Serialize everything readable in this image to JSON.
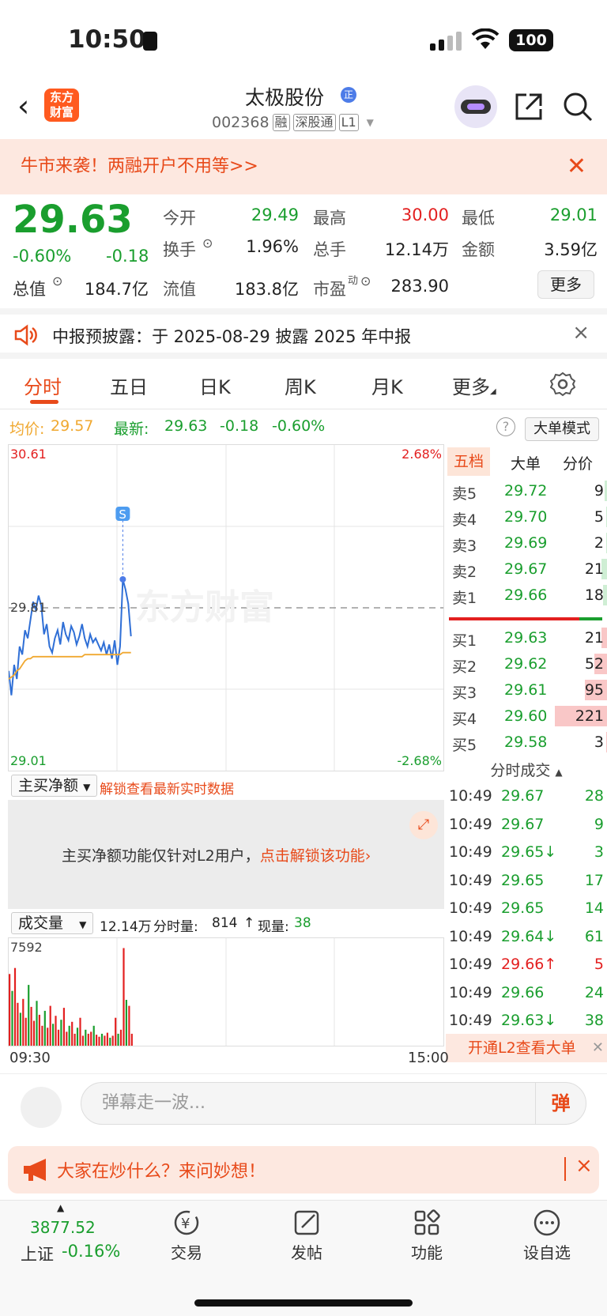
{
  "status": {
    "time": "10:50",
    "battery": "100"
  },
  "header": {
    "brand_top": "东方",
    "brand_bottom": "财富",
    "title": "太极股份",
    "badge": "正",
    "code": "002368",
    "tags": [
      "融",
      "深股通",
      "L1"
    ]
  },
  "promo": {
    "text": "牛市来袭！两融开户不用等>>"
  },
  "quote": {
    "price": "29.63",
    "pct": "-0.60%",
    "change": "-0.18",
    "grid": [
      {
        "label": "今开",
        "value": "29.49",
        "color": "green"
      },
      {
        "label": "最高",
        "value": "30.00",
        "color": "red"
      },
      {
        "label": "最低",
        "value": "29.01",
        "color": "green"
      },
      {
        "label": "换手",
        "value": "1.96%",
        "color": ""
      },
      {
        "label": "总手",
        "value": "12.14万",
        "color": ""
      },
      {
        "label": "金额",
        "value": "3.59亿",
        "color": ""
      },
      {
        "label": "总值",
        "value": "184.7亿",
        "color": ""
      },
      {
        "label": "流值",
        "value": "183.8亿",
        "color": ""
      },
      {
        "label": "市盈",
        "value": "283.90",
        "color": ""
      }
    ],
    "pe_sup": "动",
    "more": "更多"
  },
  "notice": {
    "text": "中报预披露：于 2025-08-29 披露 2025 年中报"
  },
  "tabs": [
    "分时",
    "五日",
    "日K",
    "周K",
    "月K",
    "更多"
  ],
  "avg": {
    "avg_label": "均价:",
    "avg_value": "29.57",
    "latest_label": "最新:",
    "latest_value": "29.63",
    "latest_chg": "-0.18",
    "latest_pct": "-0.60%",
    "big_mode": "大单模式",
    "help": "?"
  },
  "chart": {
    "y_top": "30.61",
    "y_mid": "29.81",
    "y_bot": "29.01",
    "pct_top": "2.68%",
    "pct_bot": "-2.68%",
    "watermark": "东方财富",
    "marker": "S"
  },
  "chart_data": {
    "type": "line",
    "title": "",
    "xlabel": "",
    "ylabel": "",
    "ylim": [
      29.01,
      30.61
    ],
    "x_range": [
      "09:30",
      "15:00"
    ],
    "series": [
      {
        "name": "",
        "color": "#2f6fd6",
        "values": [
          29.5,
          29.38,
          29.53,
          29.46,
          29.62,
          29.58,
          29.7,
          29.66,
          29.75,
          29.84,
          29.8,
          29.87,
          29.82,
          29.68,
          29.73,
          29.62,
          29.59,
          29.66,
          29.7,
          29.63,
          29.74,
          29.68,
          29.65,
          29.72,
          29.69,
          29.63,
          29.67,
          29.73,
          29.66,
          29.62,
          29.68,
          29.64,
          29.66,
          29.63,
          29.6,
          29.64,
          29.58,
          29.63,
          29.56,
          29.65,
          29.53,
          29.62,
          29.95,
          29.9,
          29.83,
          29.67
        ]
      },
      {
        "name": "",
        "color": "#f0a830",
        "values": [
          29.46,
          29.47,
          29.48,
          29.5,
          29.51,
          29.53,
          29.55,
          29.56,
          29.56,
          29.57,
          29.57,
          29.57,
          29.57,
          29.57,
          29.57,
          29.57,
          29.57,
          29.57,
          29.57,
          29.57,
          29.57,
          29.57,
          29.57,
          29.57,
          29.57,
          29.57,
          29.57,
          29.57,
          29.58,
          29.58,
          29.58,
          29.58,
          29.58,
          29.58,
          29.58,
          29.58,
          29.58,
          29.58,
          29.58,
          29.58,
          29.58,
          29.58,
          29.59,
          29.59,
          29.59,
          29.59
        ]
      }
    ]
  },
  "orderbook": {
    "tabs": [
      "五档",
      "大单",
      "分价"
    ],
    "asks": [
      {
        "name": "卖5",
        "price": "29.72",
        "vol": "9",
        "share": 0.04
      },
      {
        "name": "卖4",
        "price": "29.70",
        "vol": "5",
        "share": 0.02
      },
      {
        "name": "卖3",
        "price": "29.69",
        "vol": "2",
        "share": 0.01
      },
      {
        "name": "卖2",
        "price": "29.67",
        "vol": "21",
        "share": 0.1
      },
      {
        "name": "卖1",
        "price": "29.66",
        "vol": "18",
        "share": 0.08
      }
    ],
    "bids": [
      {
        "name": "买1",
        "price": "29.63",
        "vol": "21",
        "share": 0.1
      },
      {
        "name": "买2",
        "price": "29.62",
        "vol": "52",
        "share": 0.24
      },
      {
        "name": "买3",
        "price": "29.61",
        "vol": "95",
        "share": 0.43
      },
      {
        "name": "买4",
        "price": "29.60",
        "vol": "221",
        "share": 1.0
      },
      {
        "name": "买5",
        "price": "29.58",
        "vol": "3",
        "share": 0.01
      }
    ]
  },
  "trades": {
    "title": "分时成交",
    "rows": [
      {
        "t": "10:49",
        "p": "29.67",
        "v": "28",
        "vc": "green"
      },
      {
        "t": "10:49",
        "p": "29.67",
        "v": "9",
        "vc": "green"
      },
      {
        "t": "10:49",
        "p": "29.65↓",
        "v": "3",
        "vc": "green"
      },
      {
        "t": "10:49",
        "p": "29.65",
        "v": "17",
        "vc": "green"
      },
      {
        "t": "10:49",
        "p": "29.65",
        "v": "14",
        "vc": "green"
      },
      {
        "t": "10:49",
        "p": "29.64↓",
        "v": "61",
        "vc": "green"
      },
      {
        "t": "10:49",
        "p": "29.66↑",
        "v": "5",
        "vc": "red"
      },
      {
        "t": "10:49",
        "p": "29.66",
        "v": "24",
        "vc": "green"
      },
      {
        "t": "10:49",
        "p": "29.63↓",
        "v": "38",
        "vc": "green"
      }
    ],
    "l2": "开通L2查看大单"
  },
  "net": {
    "select": "主买净额",
    "unlock": "解锁查看最新实时数据",
    "msg": "主买净额功能仅针对L2用户，",
    "link": "点击解锁该功能"
  },
  "volume": {
    "select": "成交量",
    "total": "12.14万",
    "minute_label": "分时量:",
    "minute": "814",
    "now_label": "现量:",
    "now": "38",
    "ymax": "7592",
    "bars": [
      0.72,
      0.55,
      0.78,
      0.43,
      0.33,
      0.47,
      0.28,
      0.61,
      0.39,
      0.25,
      0.45,
      0.31,
      0.2,
      0.35,
      0.18,
      0.4,
      0.22,
      0.3,
      0.16,
      0.26,
      0.38,
      0.14,
      0.2,
      0.24,
      0.12,
      0.18,
      0.28,
      0.1,
      0.16,
      0.12,
      0.14,
      0.2,
      0.11,
      0.09,
      0.12,
      0.1,
      0.13,
      0.08,
      0.1,
      0.28,
      0.12,
      0.16,
      0.98,
      0.46,
      0.4,
      0.12
    ],
    "t_start": "09:30",
    "t_end": "15:00"
  },
  "danmu": {
    "placeholder": "弹幕走一波...",
    "button": "弹"
  },
  "ask": {
    "text": "大家在炒什么？来问妙想！"
  },
  "bottom": {
    "index_value": "3877.52",
    "index_name": "上证",
    "index_pct": "-0.16%",
    "items": [
      "交易",
      "发帖",
      "功能",
      "设自选"
    ]
  }
}
